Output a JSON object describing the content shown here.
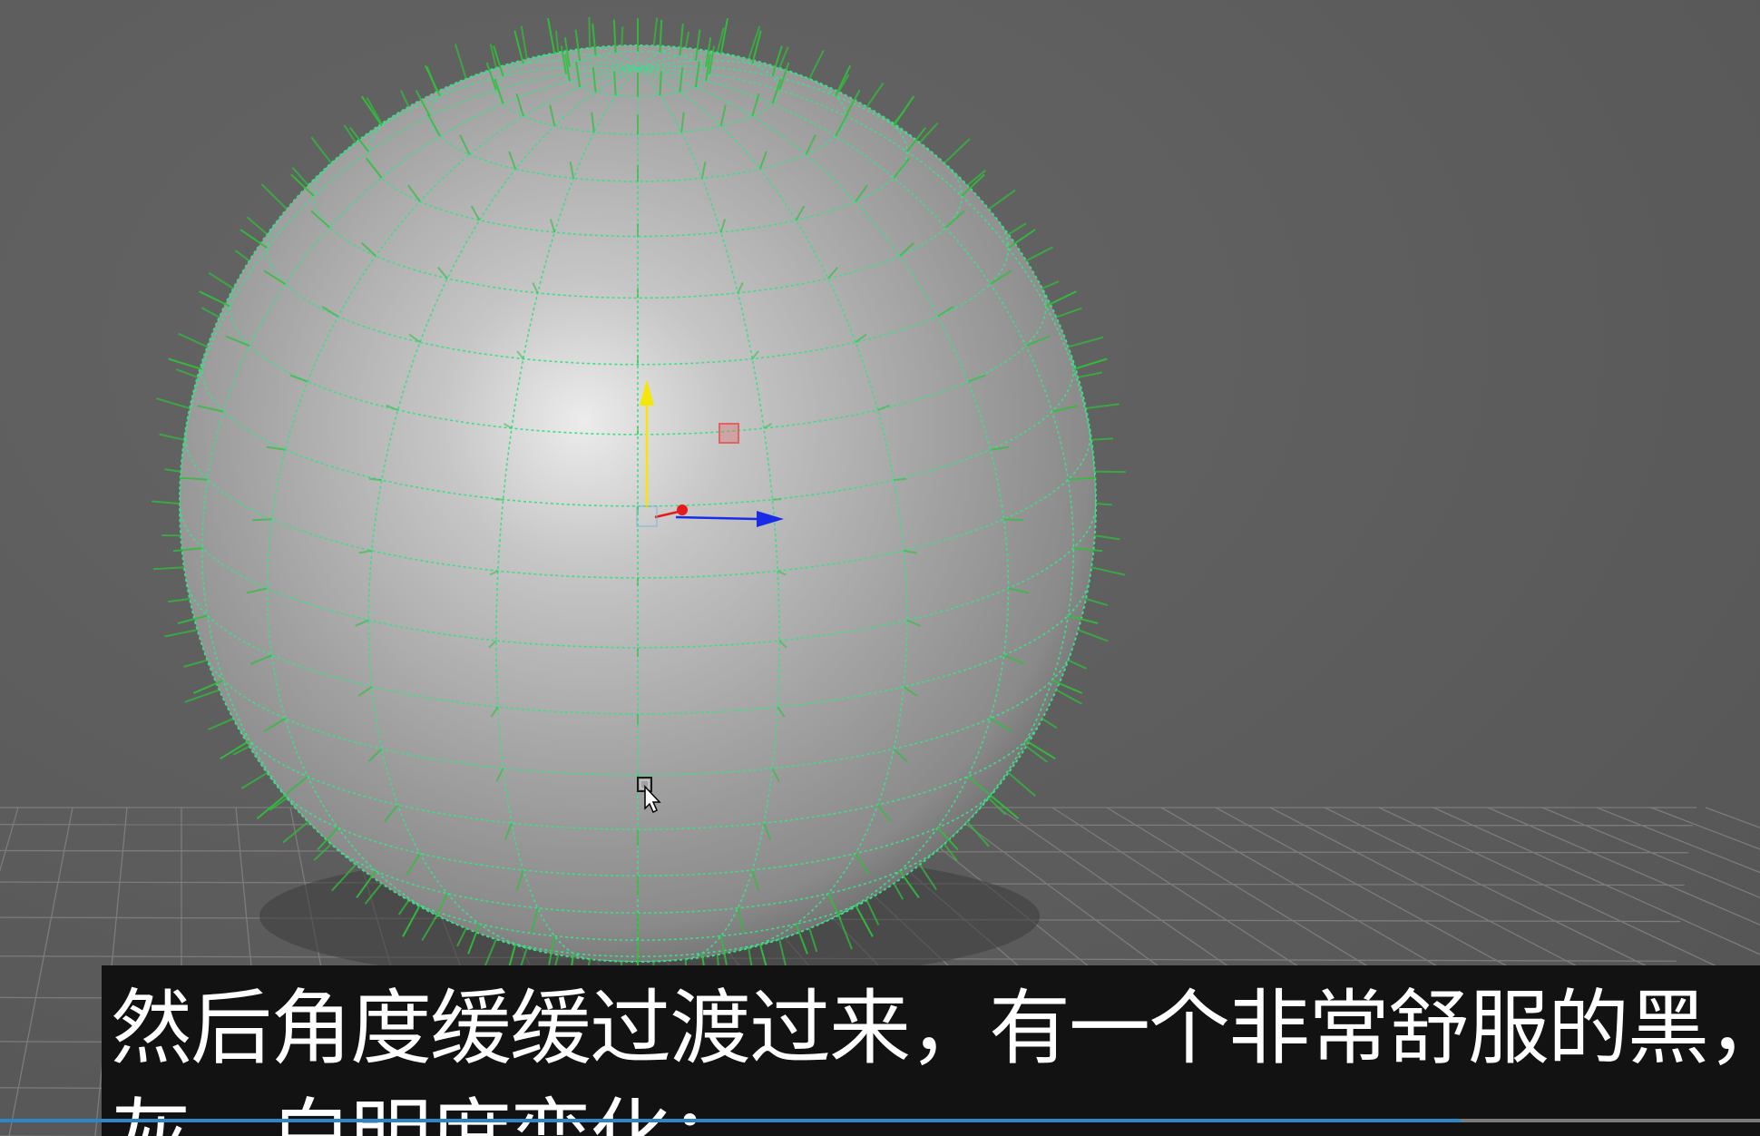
{
  "viewport": {
    "name": "3d-viewport",
    "background_color": "#5d5d5d",
    "object": "polygon-sphere",
    "wireframe_color": "#3fdc8a",
    "normals_color": "#2fbf3a",
    "manipulator": {
      "y_axis_color": "#f5e60a",
      "x_axis_color": "#1a2be6",
      "pivot_color": "#e61a1a",
      "scale_handle_color": "#e06464"
    },
    "cursor_icon": "pointer-icon"
  },
  "subtitle": {
    "line1": "然后角度缓缓过渡过来，有一个非常舒服的黑，",
    "line2": "灰、白明度变化；",
    "text_color": "#ffffff",
    "background_color": "#121212"
  },
  "progress": {
    "fraction": 0.83,
    "color": "#2f86c7"
  }
}
